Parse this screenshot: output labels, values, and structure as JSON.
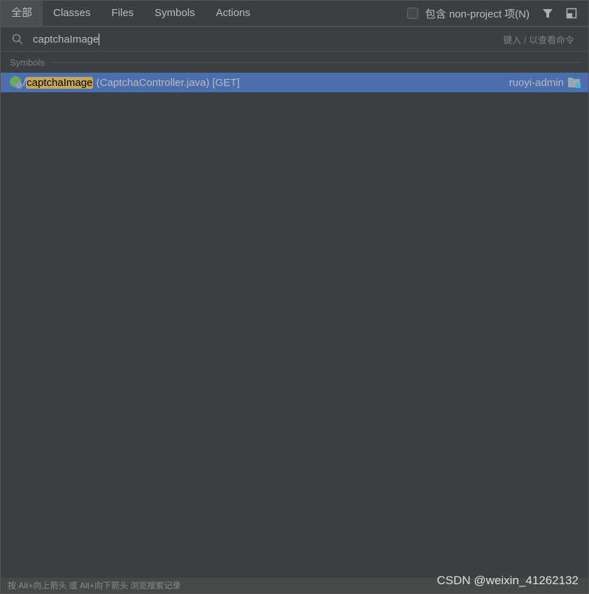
{
  "tabs": [
    {
      "label": "全部"
    },
    {
      "label": "Classes"
    },
    {
      "label": "Files"
    },
    {
      "label": "Symbols"
    },
    {
      "label": "Actions"
    }
  ],
  "include_non_project": {
    "label": "包含 non-project 项(N)",
    "checked": false
  },
  "search": {
    "value": "captchaImage",
    "hint": "键入 / 以查看命令"
  },
  "section": "Symbols",
  "result": {
    "prefix": "/",
    "match": "captchaImage",
    "detail": " (CaptchaController.java) [GET]",
    "module": "ruoyi-admin"
  },
  "footer": "按 Alt+向上箭头 或 Alt+向下箭头 浏览搜索记录",
  "watermark": "CSDN @weixin_41262132"
}
